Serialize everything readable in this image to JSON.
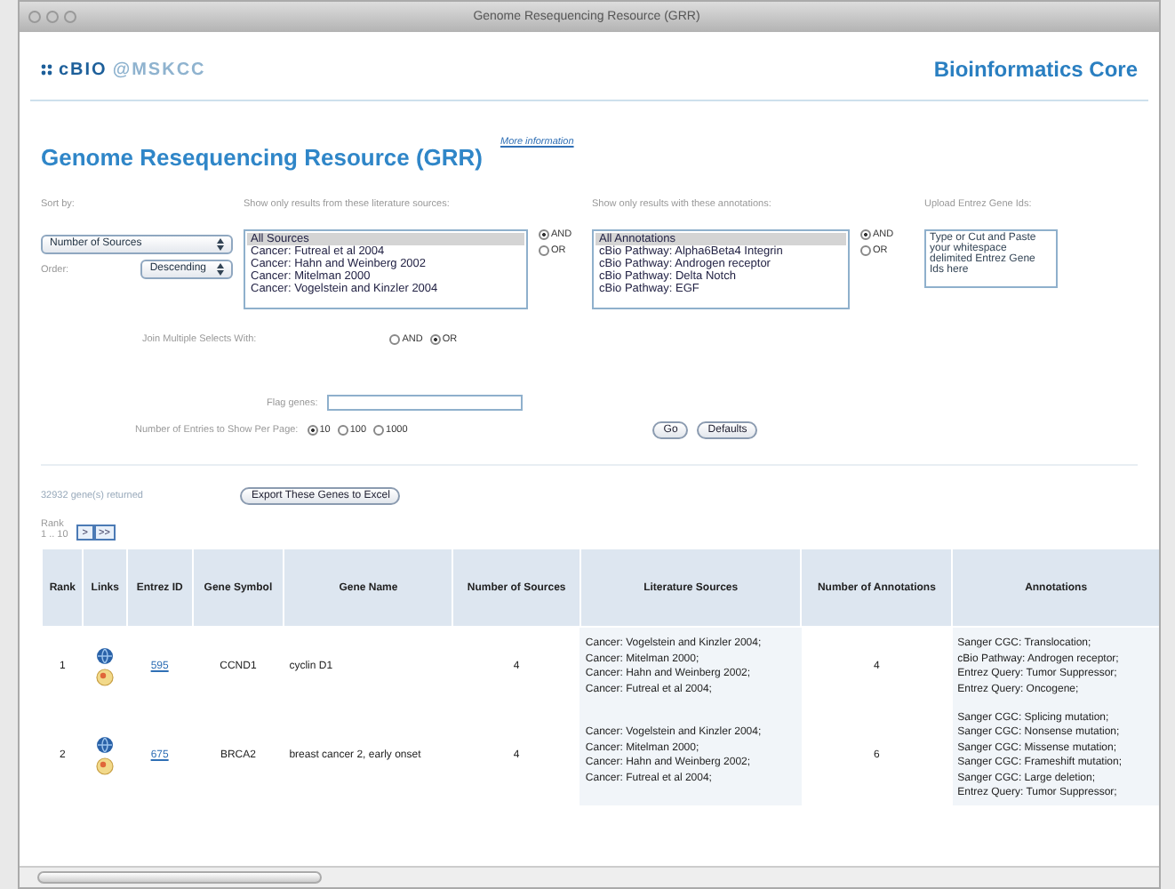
{
  "window": {
    "title": "Genome Resequencing Resource (GRR)"
  },
  "header": {
    "logo_brand": "cBIO",
    "logo_suffix": "@MSKCC",
    "title": "Bioinformatics Core"
  },
  "page": {
    "title": "Genome Resequencing Resource (GRR)",
    "more_info": "More information"
  },
  "filters": {
    "sort": {
      "label": "Sort by:",
      "value": "Number of Sources",
      "order_label": "Order:",
      "order_value": "Descending"
    },
    "sources": {
      "label": "Show only results from these literature sources:",
      "options": [
        {
          "text": "All Sources",
          "selected": true
        },
        {
          "text": "Cancer: Futreal et al 2004",
          "selected": false
        },
        {
          "text": "Cancer: Hahn and Weinberg 2002",
          "selected": false
        },
        {
          "text": "Cancer: Mitelman 2000",
          "selected": false
        },
        {
          "text": "Cancer: Vogelstein and Kinzler 2004",
          "selected": false
        }
      ],
      "combine": [
        {
          "label": "AND",
          "selected": true
        },
        {
          "label": "OR",
          "selected": false
        }
      ]
    },
    "annotations": {
      "label": "Show only results with these annotations:",
      "options": [
        {
          "text": "All Annotations",
          "selected": true
        },
        {
          "text": "cBio Pathway: Alpha6Beta4 Integrin",
          "selected": false
        },
        {
          "text": "cBio Pathway: Androgen receptor",
          "selected": false
        },
        {
          "text": "cBio Pathway: Delta Notch",
          "selected": false
        },
        {
          "text": "cBio Pathway: EGF",
          "selected": false
        }
      ],
      "combine": [
        {
          "label": "AND",
          "selected": true
        },
        {
          "label": "OR",
          "selected": false
        }
      ]
    },
    "upload": {
      "label": "Upload Entrez Gene Ids:",
      "placeholder": "Type or Cut and Paste your whitespace delimited Entrez Gene Ids here"
    },
    "join": {
      "label": "Join Multiple Selects With:",
      "options": [
        {
          "label": "AND",
          "selected": false
        },
        {
          "label": "OR",
          "selected": true
        }
      ]
    },
    "flag_genes": {
      "label": "Flag genes:"
    },
    "entries": {
      "label": "Number of Entries to Show Per Page:",
      "options": [
        {
          "label": "10",
          "selected": true
        },
        {
          "label": "100",
          "selected": false
        },
        {
          "label": "1000",
          "selected": false
        }
      ]
    },
    "buttons": [
      "Go",
      "Defaults"
    ]
  },
  "results": {
    "count": "32932 gene(s) returned",
    "export": "Export These Genes to Excel",
    "rank_label": "Rank",
    "rank_range": "1 .. 10",
    "pager": [
      ">",
      ">>"
    ]
  },
  "table": {
    "columns": [
      "Rank",
      "Links",
      "Entrez ID",
      "Gene Symbol",
      "Gene Name",
      "Number of Sources",
      "Literature Sources",
      "Number of Annotations",
      "Annotations"
    ],
    "rows": [
      {
        "rank": "1",
        "entrez_id": "595",
        "symbol": "CCND1",
        "name": "cyclin D1",
        "num_sources": "4",
        "sources": [
          "Cancer: Vogelstein and Kinzler 2004;",
          "Cancer: Mitelman 2000;",
          "Cancer: Hahn and Weinberg 2002;",
          "Cancer: Futreal et al 2004;"
        ],
        "num_annotations": "4",
        "annotations": [
          "Sanger CGC: Translocation;",
          "cBio Pathway: Androgen receptor;",
          "Entrez Query: Tumor Suppressor;",
          "Entrez Query: Oncogene;"
        ]
      },
      {
        "rank": "2",
        "entrez_id": "675",
        "symbol": "BRCA2",
        "name": "breast cancer 2, early onset",
        "num_sources": "4",
        "sources": [
          "Cancer: Vogelstein and Kinzler 2004;",
          "Cancer: Mitelman 2000;",
          "Cancer: Hahn and Weinberg 2002;",
          "Cancer: Futreal et al 2004;"
        ],
        "num_annotations": "6",
        "annotations": [
          "Sanger CGC: Splicing mutation;",
          "Sanger CGC: Nonsense mutation;",
          "Sanger CGC: Missense mutation;",
          "Sanger CGC: Frameshift mutation;",
          "Sanger CGC: Large deletion;",
          "Entrez Query: Tumor Suppressor;"
        ]
      }
    ]
  }
}
